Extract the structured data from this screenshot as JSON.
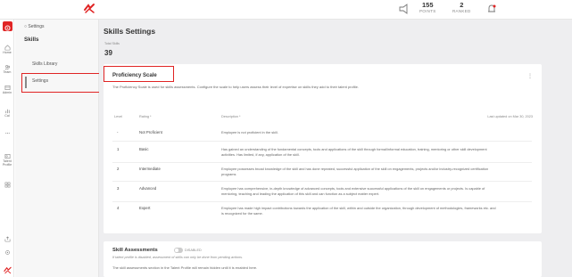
{
  "topbar": {
    "points": {
      "value": "155",
      "label": "POINTS"
    },
    "ranked": {
      "value": "2",
      "label": "RANKED"
    }
  },
  "leftnav": {
    "items": [
      {
        "label": "Home",
        "icon": "home-icon"
      },
      {
        "label": "Team",
        "icon": "team-icon"
      },
      {
        "label": "Admin",
        "icon": "admin-icon"
      },
      {
        "label": "Cal",
        "icon": "calendar-icon"
      },
      {
        "label": "Talent Profile",
        "icon": "talent-profile-icon"
      }
    ]
  },
  "subnav": {
    "breadcrumb": "Settings",
    "title": "Skills",
    "items": [
      {
        "label": "Skills Library"
      },
      {
        "label": "Settings"
      }
    ]
  },
  "main": {
    "title": "Skills Settings",
    "total_label": "Total Skills",
    "total_value": "39"
  },
  "proficiency": {
    "title": "Proficiency Scale",
    "description": "The Proficiency Scale is used for skills assessments. Configure the scale to help users assess their level of expertise on skills they add to their talent profile.",
    "columns": {
      "level": "Level",
      "rating": "Rating *",
      "description": "Description *"
    },
    "updated": "Last updated on Mar 30, 2023",
    "rows": [
      {
        "level": "-",
        "rating": "Not Proficient",
        "description": "Employee is not proficient in the skill."
      },
      {
        "level": "1",
        "rating": "Basic",
        "description": "Has gained an understanding of the fundamental concepts, tools and applications of the skill through formal/informal education, training, mentoring or other skill development activities. Has limited, if any, application of the skill."
      },
      {
        "level": "2",
        "rating": "Intermediate",
        "description": "Employee possesses broad knowledge of the skill and has done repeated, successful application of the skill on engagements, projects and/or industry-recognized certification programs"
      },
      {
        "level": "3",
        "rating": "Advanced",
        "description": "Employee has comprehensive, in-depth knowledge of advanced concepts, tools and extensive successful applications of the skill on engagements or projects. Is capable of mentoring, teaching and leading the application of this skill and can function as a subject matter expert."
      },
      {
        "level": "4",
        "rating": "Expert",
        "description": "Employee has made high impact contributions towards the application of the skill, within and outside the organization, through development of methodologies, frameworks etc. and is recognized for the same."
      }
    ]
  },
  "skill_assessments": {
    "title": "Skill Assessments",
    "status": "DISABLED",
    "note": "If talent profile is disabled, assessment of skills can only be done from pending actions.",
    "description": "The skill assessments section in the Talent Profile will remain hidden until it is enabled here."
  },
  "colors": {
    "accent": "#e02424",
    "page_bg": "#eeeef0"
  }
}
